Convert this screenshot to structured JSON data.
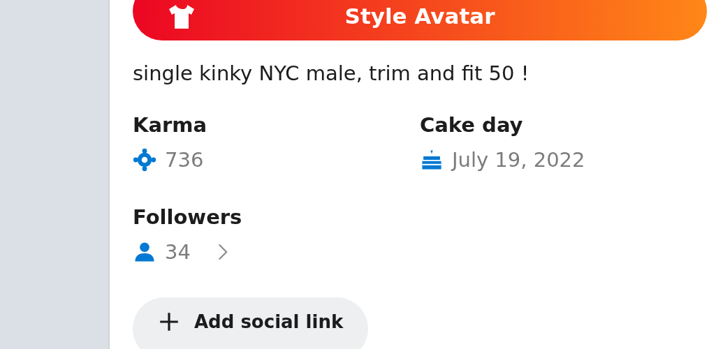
{
  "style_button": {
    "label": "Style Avatar"
  },
  "description": "single kinky NYC male, trim and fit 50 !",
  "stats": [
    {
      "kind": "karma",
      "label": "Karma",
      "value": "736"
    },
    {
      "kind": "cakeday",
      "label": "Cake day",
      "value": "July 19, 2022"
    },
    {
      "kind": "followers",
      "label": "Followers",
      "value": "34"
    }
  ],
  "social_button": {
    "label": "Add social link"
  }
}
